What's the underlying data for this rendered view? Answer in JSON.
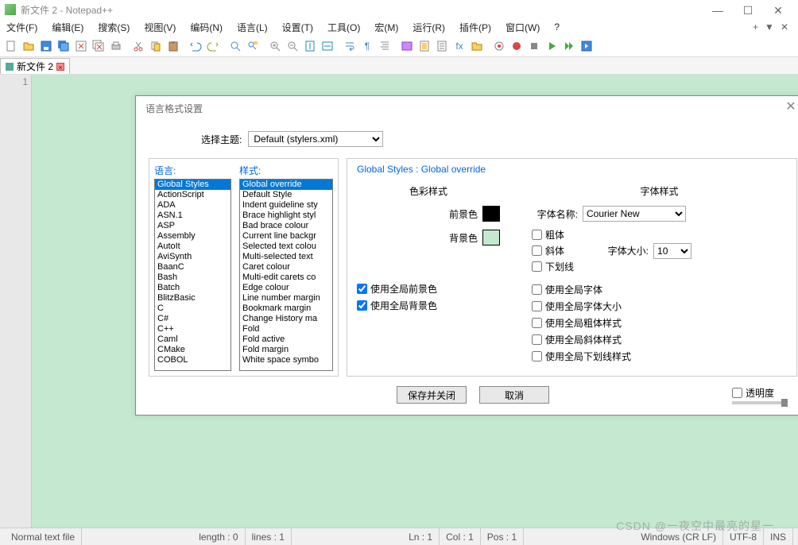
{
  "window": {
    "title": "新文件 2 - Notepad++"
  },
  "menus": [
    "文件(F)",
    "编辑(E)",
    "搜索(S)",
    "视图(V)",
    "编码(N)",
    "语言(L)",
    "设置(T)",
    "工具(O)",
    "宏(M)",
    "运行(R)",
    "插件(P)",
    "窗口(W)",
    "?"
  ],
  "tab": {
    "label": "新文件 2"
  },
  "gutter_first_line": "1",
  "dialog": {
    "title": "语言格式设置",
    "theme_label": "选择主题:",
    "theme_value": "Default (stylers.xml)",
    "lang_label": "语言:",
    "style_label": "样式:",
    "languages": [
      "Global Styles",
      "ActionScript",
      "ADA",
      "ASN.1",
      "ASP",
      "Assembly",
      "AutoIt",
      "AviSynth",
      "BaanC",
      "Bash",
      "Batch",
      "BlitzBasic",
      "C",
      "C#",
      "C++",
      "Caml",
      "CMake",
      "COBOL"
    ],
    "lang_selected_index": 0,
    "styles": [
      "Global override",
      "Default Style",
      "Indent guideline sty",
      "Brace highlight styl",
      "Bad brace colour",
      "Current line backgr",
      "Selected text colou",
      "Multi-selected text",
      "Caret colour",
      "Multi-edit carets co",
      "Edge colour",
      "Line number margin",
      "Bookmark margin",
      "Change History ma",
      "Fold",
      "Fold active",
      "Fold margin",
      "White space symbo"
    ],
    "style_selected_index": 0,
    "rp_title": "Global Styles : Global override",
    "color_head": "色彩样式",
    "fg_label": "前景色",
    "bg_label": "背景色",
    "font_head": "字体样式",
    "font_name_label": "字体名称:",
    "font_name_value": "Courier New",
    "font_size_label": "字体大小:",
    "font_size_value": "10",
    "bold": "粗体",
    "italic": "斜体",
    "underline": "下划线",
    "use_global_fg": "使用全局前景色",
    "use_global_bg": "使用全局背景色",
    "use_global_font": "使用全局字体",
    "use_global_size": "使用全局字体大小",
    "use_global_bold": "使用全局粗体样式",
    "use_global_italic": "使用全局斜体样式",
    "use_global_underline": "使用全局下划线样式",
    "save_close": "保存并关闭",
    "cancel": "取消",
    "transparency": "透明度"
  },
  "status": {
    "type": "Normal text file",
    "length": "length : 0",
    "lines": "lines : 1",
    "ln": "Ln : 1",
    "col": "Col : 1",
    "pos": "Pos : 1",
    "eol": "Windows (CR LF)",
    "enc": "UTF-8",
    "ins": "INS"
  },
  "watermark": "CSDN @一夜空中最亮的星一"
}
